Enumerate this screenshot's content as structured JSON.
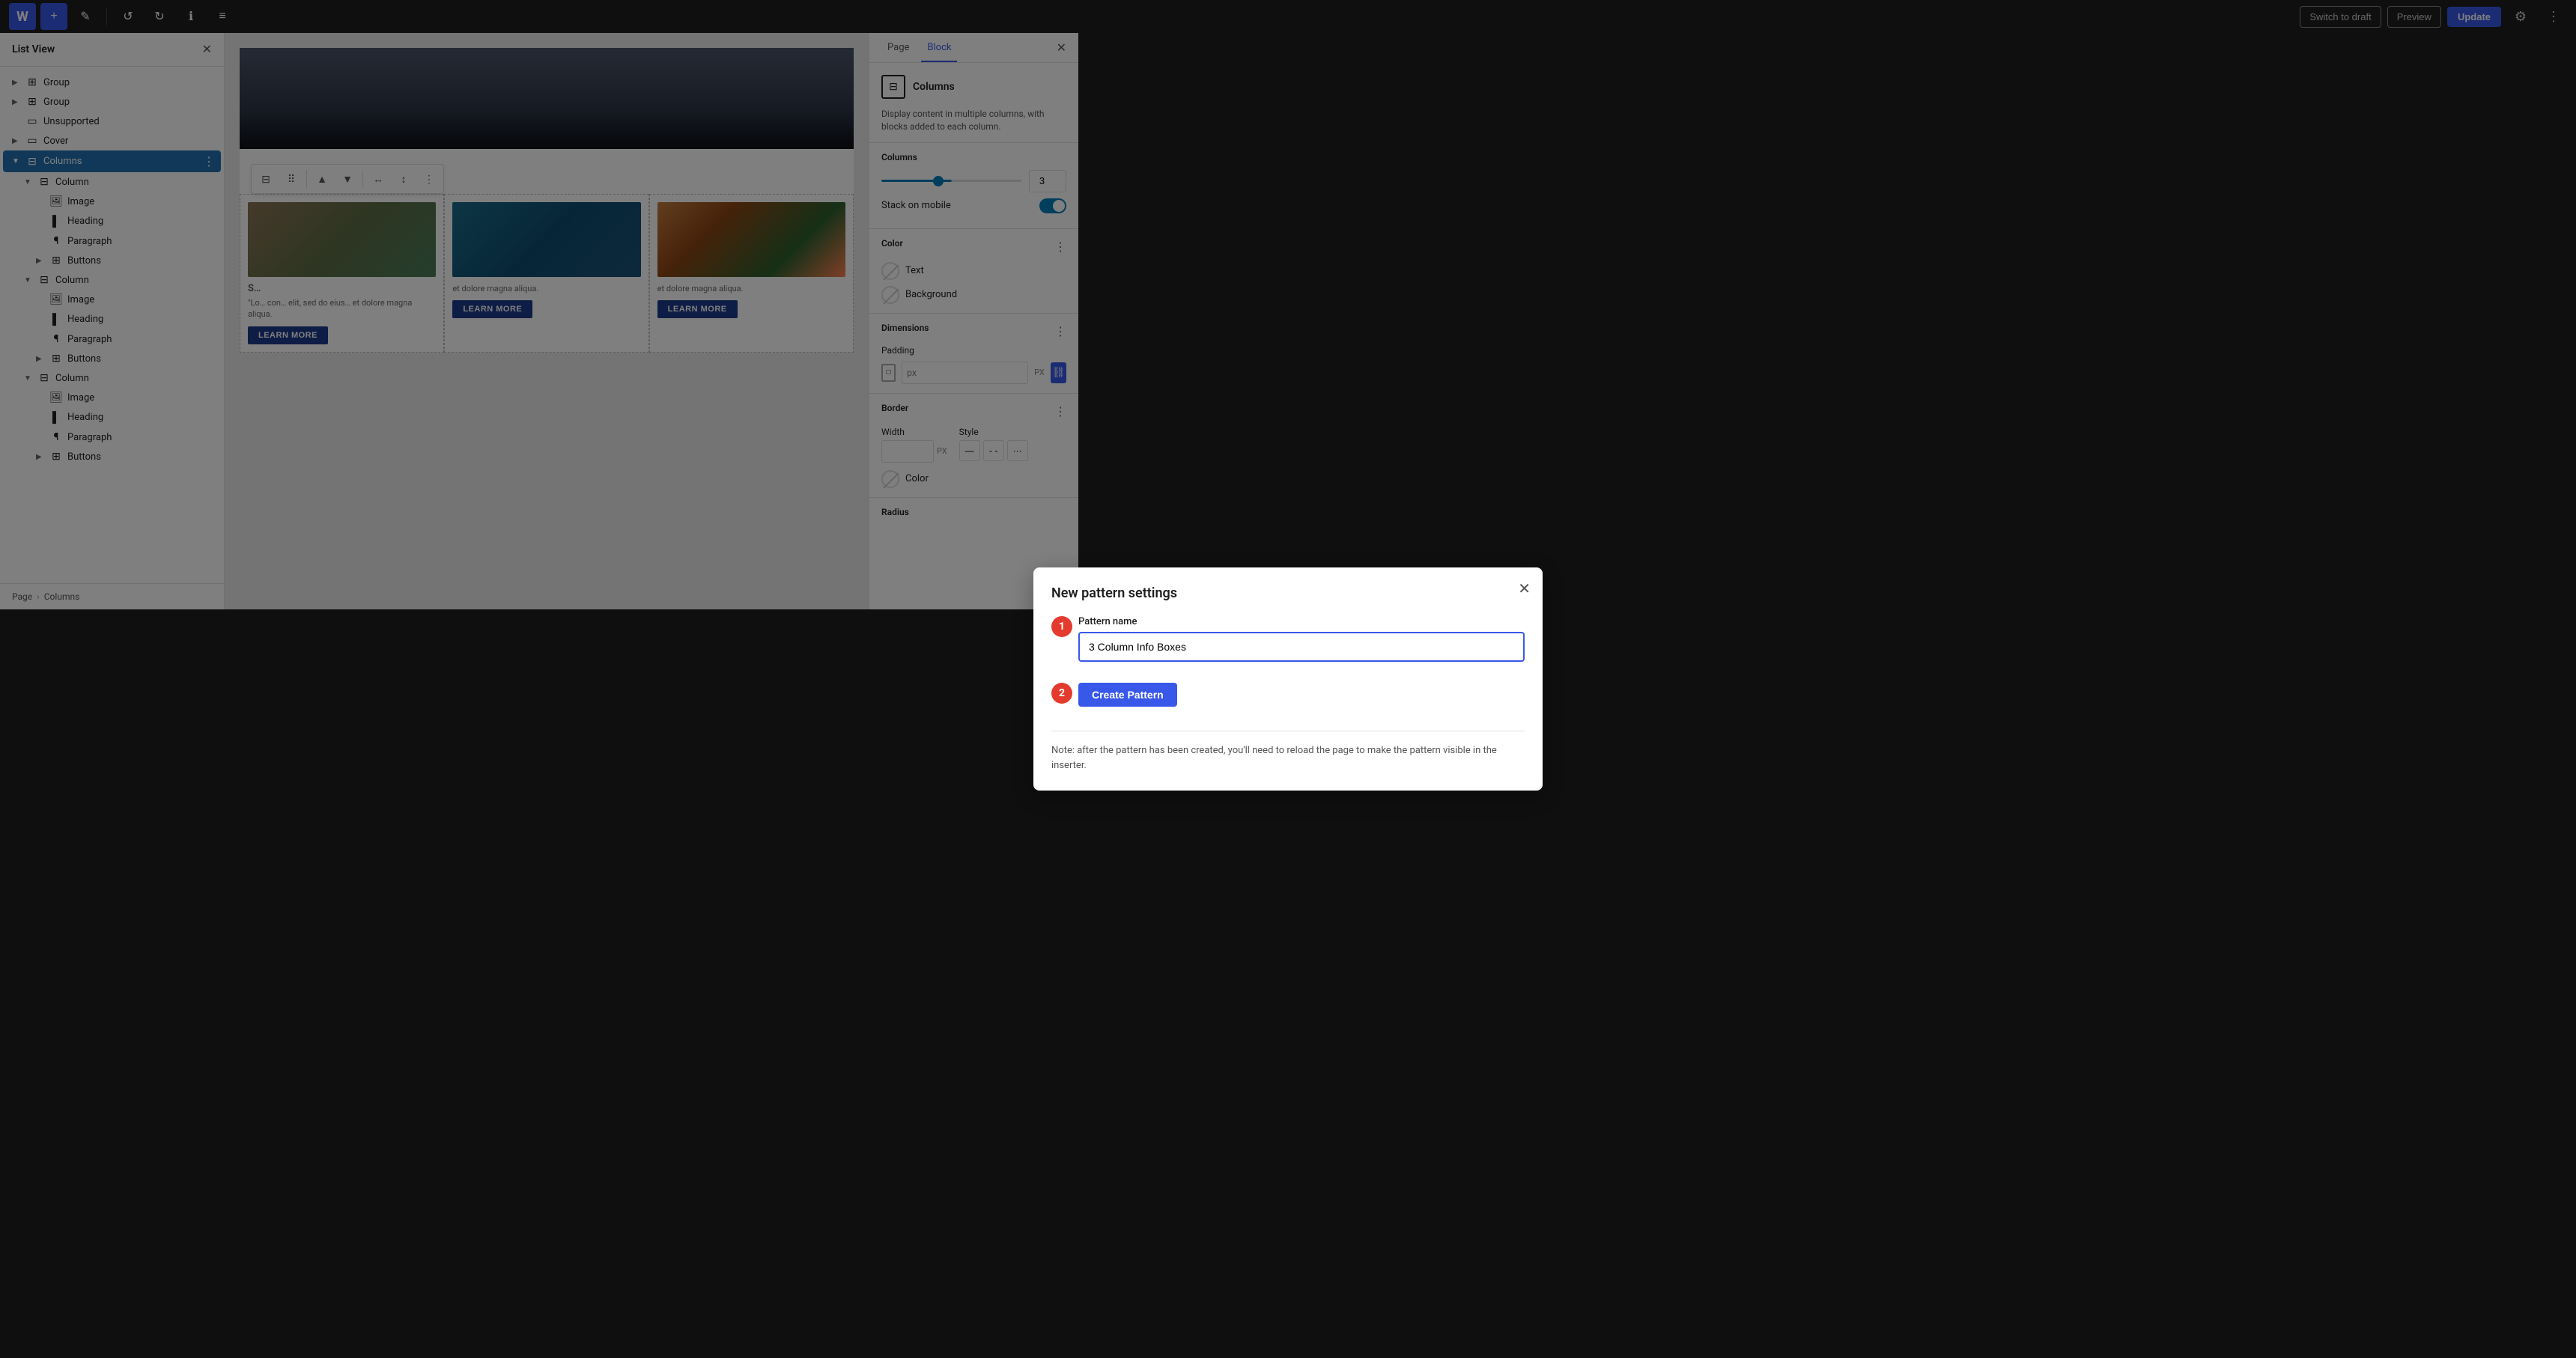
{
  "topbar": {
    "wp_logo": "W",
    "add_label": "+",
    "edit_label": "✎",
    "undo_label": "↺",
    "redo_label": "↻",
    "info_label": "ℹ",
    "list_view_label": "≡",
    "switch_draft_label": "Switch to draft",
    "preview_label": "Preview",
    "update_label": "Update",
    "gear_label": "⚙",
    "dots_label": "⋮"
  },
  "sidebar_left": {
    "title": "List View",
    "close_label": "✕",
    "items": [
      {
        "id": "group1",
        "label": "Group",
        "indent": 0,
        "expand": "▶",
        "icon": "⊞"
      },
      {
        "id": "group2",
        "label": "Group",
        "indent": 0,
        "expand": "▶",
        "icon": "⊞"
      },
      {
        "id": "unsupported",
        "label": "Unsupported",
        "indent": 0,
        "expand": "",
        "icon": "▭"
      },
      {
        "id": "cover",
        "label": "Cover",
        "indent": 0,
        "expand": "▶",
        "icon": "▭"
      },
      {
        "id": "columns",
        "label": "Columns",
        "indent": 0,
        "expand": "▼",
        "icon": "⊟",
        "active": true
      },
      {
        "id": "column1",
        "label": "Column",
        "indent": 1,
        "expand": "▼",
        "icon": "⊟"
      },
      {
        "id": "image1",
        "label": "Image",
        "indent": 2,
        "expand": "",
        "icon": "🖼"
      },
      {
        "id": "heading1",
        "label": "Heading",
        "indent": 2,
        "expand": "",
        "icon": "▌"
      },
      {
        "id": "paragraph1",
        "label": "Paragraph",
        "indent": 2,
        "expand": "",
        "icon": "¶"
      },
      {
        "id": "buttons1",
        "label": "Buttons",
        "indent": 2,
        "expand": "▶",
        "icon": "⊞"
      },
      {
        "id": "column2",
        "label": "Column",
        "indent": 1,
        "expand": "▼",
        "icon": "⊟"
      },
      {
        "id": "image2",
        "label": "Image",
        "indent": 2,
        "expand": "",
        "icon": "🖼"
      },
      {
        "id": "heading2",
        "label": "Heading",
        "indent": 2,
        "expand": "",
        "icon": "▌"
      },
      {
        "id": "paragraph2",
        "label": "Paragraph",
        "indent": 2,
        "expand": "",
        "icon": "¶"
      },
      {
        "id": "buttons2",
        "label": "Buttons",
        "indent": 2,
        "expand": "▶",
        "icon": "⊞"
      },
      {
        "id": "column3",
        "label": "Column",
        "indent": 1,
        "expand": "▼",
        "icon": "⊟"
      },
      {
        "id": "image3",
        "label": "Image",
        "indent": 2,
        "expand": "",
        "icon": "🖼"
      },
      {
        "id": "heading3",
        "label": "Heading",
        "indent": 2,
        "expand": "",
        "icon": "▌"
      },
      {
        "id": "paragraph3",
        "label": "Paragraph",
        "indent": 2,
        "expand": "",
        "icon": "¶"
      },
      {
        "id": "buttons3",
        "label": "Buttons",
        "indent": 2,
        "expand": "▶",
        "icon": "⊞"
      }
    ],
    "footer_page": "Page",
    "footer_sep": "›",
    "footer_columns": "Columns"
  },
  "canvas": {
    "toolbar_btns": [
      "⊟",
      "⠿",
      "↕",
      "↔",
      "↑",
      "⋮"
    ],
    "columns": [
      {
        "title": "S…",
        "text": "\"Lo… con… elit, sed do eius… et dolore magna aliqua.",
        "btn_label": "LEARN MORE"
      },
      {
        "title": "",
        "text": "et dolore magna aliqua.",
        "btn_label": "LEARN MORE"
      },
      {
        "title": "",
        "text": "et dolore magna aliqua.",
        "btn_label": "LEARN MORE"
      }
    ]
  },
  "sidebar_right": {
    "tab_page": "Page",
    "tab_block": "Block",
    "close_label": "✕",
    "block_icon": "⊟",
    "block_title": "Columns",
    "block_desc": "Display content in multiple columns, with blocks added to each column.",
    "columns_label": "Columns",
    "columns_value": "3",
    "stack_mobile_label": "Stack on mobile",
    "color_label": "Color",
    "color_text_label": "Text",
    "color_bg_label": "Background",
    "dimensions_label": "Dimensions",
    "padding_label": "Padding",
    "border_label": "Border",
    "border_width_label": "Width",
    "border_style_label": "Style",
    "radius_label": "Radius",
    "more_icon": "⋮"
  },
  "modal": {
    "title": "New pattern settings",
    "close_label": "✕",
    "pattern_name_label": "Pattern name",
    "pattern_name_value": "3 Column Info Boxes",
    "pattern_name_placeholder": "3 Column Info Boxes",
    "create_btn_label": "Create Pattern",
    "note_text": "Note: after the pattern has been created, you'll need to reload the page to make the pattern visible in the inserter.",
    "step1_label": "1",
    "step2_label": "2"
  }
}
